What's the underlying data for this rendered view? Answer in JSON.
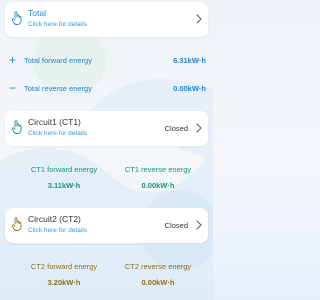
{
  "total": {
    "title": "Total",
    "subtitle": "Click here for details"
  },
  "totals": {
    "forward": {
      "label": "Total forward energy",
      "value": "6.31kW·h"
    },
    "reverse": {
      "label": "Total reverse energy",
      "value": "0.00kW·h"
    }
  },
  "circuits": [
    {
      "title": "Circuit1 (CT1)",
      "subtitle": "Click here for details",
      "status": "Closed",
      "forward_label": "CT1 forward energy",
      "forward_value": "3.11kW·h",
      "reverse_label": "CT1 reverse energy",
      "reverse_value": "0.00kW·h"
    },
    {
      "title": "Circuit2 (CT2)",
      "subtitle": "Click here for details",
      "status": "Closed",
      "forward_label": "CT2 forward energy",
      "forward_value": "3.20kW·h",
      "reverse_label": "CT2 reverse energy",
      "reverse_value": "0.00kW·h"
    }
  ],
  "icons": {
    "card": "hand-pointer-icon",
    "chevron": "chevron-right-icon",
    "plus": "plus-icon",
    "minus": "minus-icon"
  },
  "colors": {
    "accent": "#1e86cf",
    "ct1": "#1f8f7f",
    "ct2": "#8a7115",
    "card": "#ffffff"
  }
}
